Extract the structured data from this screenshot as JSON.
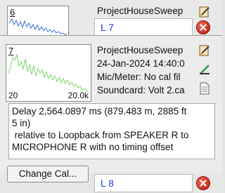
{
  "top_measurement": {
    "number": "6",
    "title": "ProjectHouseSweep",
    "name_value": "L 7"
  },
  "measurement": {
    "number": "7",
    "x_min_label": "20",
    "x_max_label": "20.0k",
    "title": "ProjectHouseSweep",
    "date": "24-Jan-2024 14:40:0",
    "mic_meter": "Mic/Meter: No cal fil",
    "soundcard": "Soundcard: Volt 2.ca",
    "delay_line1": "Delay 2,564.0897 ms (879.483 m, 2885 ft",
    "delay_line2": "5 in)",
    "delay_line3": " relative to Loopback from SPEAKER R to",
    "delay_line4": "MICROPHONE R with no timing offset",
    "change_cal_label": "Change Cal..."
  },
  "bottom_measurement": {
    "name_value": "L 8"
  },
  "icons": {
    "edit": "pencil-edit-icon",
    "line": "green-line-icon",
    "notes": "document-notes-icon",
    "delete": "delete-x-icon"
  },
  "colors": {
    "name_text": "#1a3fcf",
    "trace_blue": "#3b6fd6",
    "trace_green": "#7ed36a",
    "delete_red": "#d23a2b"
  }
}
